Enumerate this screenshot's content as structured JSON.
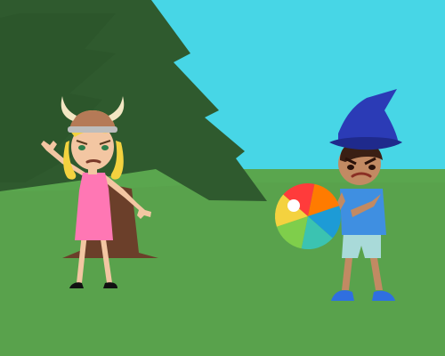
{
  "scene": {
    "background": {
      "sky_color": "#47d6e6",
      "grass_color": "#5aa64e"
    },
    "tree": {
      "foliage_color": "#2f5a2e",
      "trunk_color": "#6b3f2a"
    },
    "girl": {
      "hat": "viking-helmet",
      "hair_color": "#f4d23f",
      "dress_color": "#ff77b4",
      "skin_color": "#f3c6a2",
      "shoe_color": "#111111",
      "expression": "angry"
    },
    "boy": {
      "hat": "wizard-hat",
      "hat_color": "#2b3bb6",
      "shirt_color": "#3f8fe1",
      "shorts_color": "#a9dad9",
      "skin_color": "#c28a63",
      "hair_color": "#3a1f14",
      "shoe_color": "#2f6fe0",
      "expression": "angry"
    },
    "beach_ball": {
      "segment_colors": [
        "#ff7b00",
        "#1d9bd6",
        "#3bc3b1",
        "#7fce4b",
        "#f4d23f",
        "#ff3b3b"
      ]
    }
  }
}
